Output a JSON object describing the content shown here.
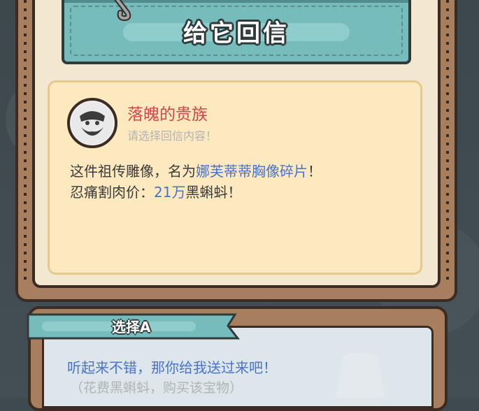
{
  "dialog": {
    "title": "给它回信"
  },
  "letter": {
    "sender_name": "落魄的贵族",
    "prompt": "请选择回信内容！",
    "body_line1_prefix": "这件祖传雕像，名为",
    "item_name": "娜芙蒂蒂胸像碎片",
    "body_line1_suffix": "！",
    "body_line2_prefix": "忍痛割肉价：",
    "price": "21万",
    "body_line2_suffix": "黑蝌蚪！"
  },
  "option_a": {
    "label": "选择A",
    "reply": "听起来不错，那你给我送过来吧！",
    "cost_note": "（花费黑蝌蚪，购买该宝物）"
  },
  "colors": {
    "sender_name": "#d1464a",
    "highlight": "#4a72c8",
    "title_sign": "#76bcbc",
    "card": "#fde9c0"
  }
}
